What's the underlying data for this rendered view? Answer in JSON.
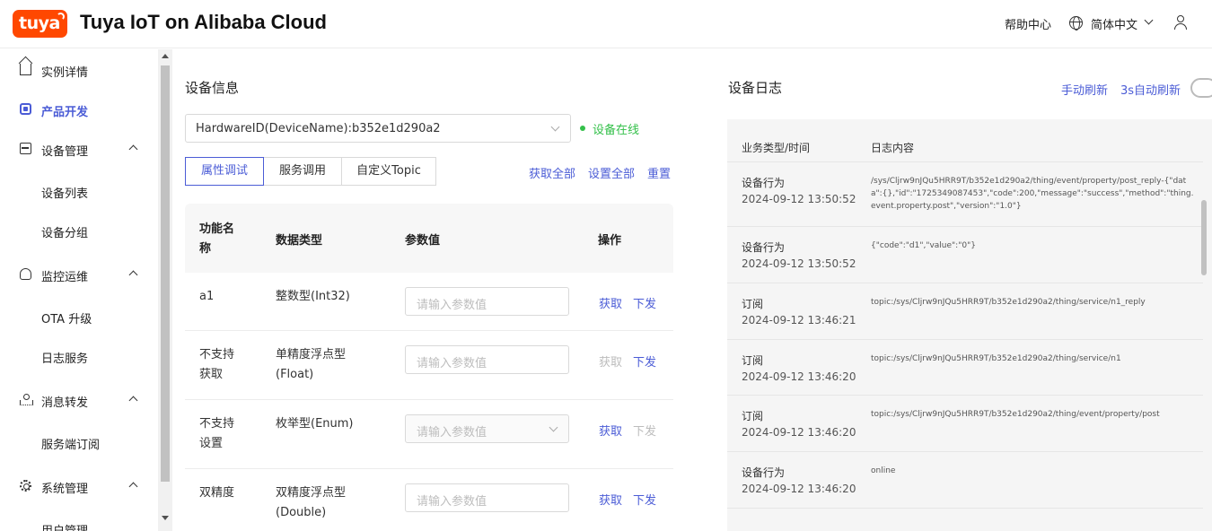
{
  "header": {
    "logo_text": "tuya",
    "title": "Tuya IoT on Alibaba Cloud",
    "help": "帮助中心",
    "language": "简体中文"
  },
  "sidebar": {
    "items": [
      {
        "label": "实例详情"
      },
      {
        "label": "产品开发"
      },
      {
        "label": "设备管理"
      },
      {
        "label": "监控运维"
      },
      {
        "label": "消息转发"
      },
      {
        "label": "系统管理"
      }
    ],
    "sub": {
      "device_list": "设备列表",
      "device_group": "设备分组",
      "ota": "OTA 升级",
      "log_service": "日志服务",
      "server_sub": "服务端订阅",
      "user_mgmt": "用户管理"
    }
  },
  "device_info": {
    "title": "设备信息",
    "selected_device": "HardwareID(DeviceName):b352e1d290a2",
    "status": "设备在线",
    "tabs": [
      "属性调试",
      "服务调用",
      "自定义Topic"
    ],
    "actions": {
      "get_all": "获取全部",
      "set_all": "设置全部",
      "reset": "重置"
    },
    "table": {
      "headers": {
        "name": "功能名称",
        "type": "数据类型",
        "value": "参数值",
        "op": "操作"
      },
      "placeholder": "请输入参数值",
      "get": "获取",
      "send": "下发",
      "rows": [
        {
          "name": "a1",
          "type": "整数型(Int32)"
        },
        {
          "name": "不支持获取",
          "type": "单精度浮点型(Float)"
        },
        {
          "name": "不支持设置",
          "type": "枚举型(Enum)"
        },
        {
          "name": "双精度",
          "type": "双精度浮点型(Double)"
        }
      ]
    }
  },
  "device_log": {
    "title": "设备日志",
    "manual_refresh": "手动刷新",
    "auto_refresh": "3s自动刷新",
    "headers": {
      "type_time": "业务类型/时间",
      "content": "日志内容"
    },
    "rows": [
      {
        "type": "设备行为",
        "time": "2024-09-12 13:50:52",
        "content": "/sys/Cljrw9nJQu5HRR9T/b352e1d290a2/thing/event/property/post_reply-{\"data\":{},\"id\":\"1725349087453\",\"code\":200,\"message\":\"success\",\"method\":\"thing.event.property.post\",\"version\":\"1.0\"}"
      },
      {
        "type": "设备行为",
        "time": "2024-09-12 13:50:52",
        "content": "{\"code\":\"d1\",\"value\":\"0\"}"
      },
      {
        "type": "订阅",
        "time": "2024-09-12 13:46:21",
        "content": "topic:/sys/Cljrw9nJQu5HRR9T/b352e1d290a2/thing/service/n1_reply"
      },
      {
        "type": "订阅",
        "time": "2024-09-12 13:46:20",
        "content": "topic:/sys/Cljrw9nJQu5HRR9T/b352e1d290a2/thing/service/n1"
      },
      {
        "type": "订阅",
        "time": "2024-09-12 13:46:20",
        "content": "topic:/sys/Cljrw9nJQu5HRR9T/b352e1d290a2/thing/event/property/post"
      },
      {
        "type": "设备行为",
        "time": "2024-09-12 13:46:20",
        "content": "online"
      }
    ]
  }
}
